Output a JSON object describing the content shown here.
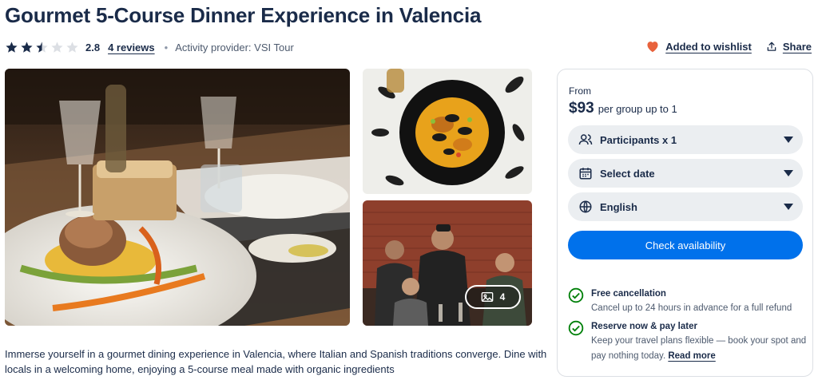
{
  "title": "Gourmet 5-Course Dinner Experience in Valencia",
  "rating": {
    "value": "2.8",
    "stars_filled": 2.5,
    "stars_total": 5
  },
  "reviews_label": "4 reviews",
  "provider": "Activity provider: VSI Tour",
  "actions": {
    "wishlist": "Added to wishlist",
    "share": "Share"
  },
  "gallery": {
    "count": "4"
  },
  "description": "Immerse yourself in a gourmet dining experience in Valencia, where Italian and Spanish traditions converge. Dine with locals in a welcoming home, enjoying a 5-course meal made with organic ingredients",
  "booking": {
    "from_label": "From",
    "price": "$93",
    "price_unit": "per group up to 1",
    "participants": "Participants x 1",
    "date": "Select date",
    "language": "English",
    "check_button": "Check availability"
  },
  "perks": [
    {
      "title": "Free cancellation",
      "text": "Cancel up to 24 hours in advance for a full refund"
    },
    {
      "title": "Reserve now & pay later",
      "text": "Keep your travel plans flexible — book your spot and pay nothing today.",
      "link": "Read more"
    }
  ],
  "colors": {
    "primary": "#0071eb",
    "text": "#1a2b49",
    "heart": "#e8623c",
    "check": "#008009",
    "select_bg": "#ebeef1"
  },
  "icons": [
    "star-icon",
    "heart-icon",
    "share-icon",
    "gallery-icon",
    "participants-icon",
    "calendar-icon",
    "globe-icon",
    "chevron-down-icon",
    "check-circle-icon"
  ]
}
